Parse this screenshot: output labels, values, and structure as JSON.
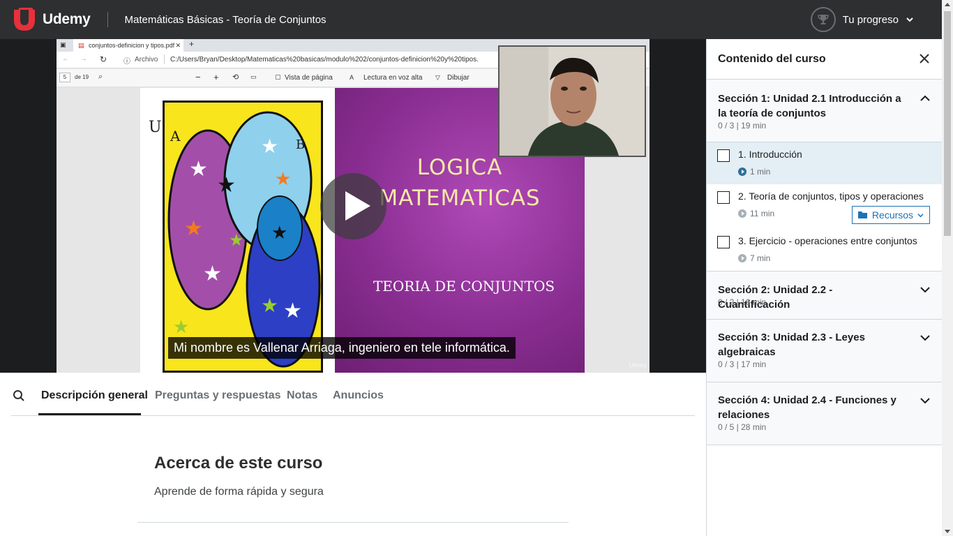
{
  "header": {
    "logo_text": "Udemy",
    "course_title": "Matemáticas Básicas - Teoría de Conjuntos",
    "progress_label": "Tu progreso"
  },
  "video": {
    "pdf_tab_title": "conjuntos-definicion y tipos.pdf",
    "address_archivo": "Archivo",
    "address_path": "C:/Users/Bryan/Desktop/Matematicas%20basicas/modulo%202/conjuntos-definicion%20y%20tipos.",
    "page_num": "5",
    "page_total": "de 19",
    "toolbar_vista": "Vista de página",
    "toolbar_lectura": "Lectura en voz alta",
    "toolbar_dibujar": "Dibujar",
    "venn_label_u": "U",
    "venn_label_a": "A",
    "venn_label_b": "B",
    "slide_title_1": "LOGICA",
    "slide_title_2": "MATEMATICAS",
    "slide_subtitle": "TEORIA DE CONJUNTOS",
    "caption": "Mi nombre es Vallenar Arriaga, ingeniero en tele informática.",
    "watermark": "Udemy"
  },
  "tabs": [
    {
      "label": "Descripción general",
      "active": true
    },
    {
      "label": "Preguntas y respuestas",
      "active": false
    },
    {
      "label": "Notas",
      "active": false
    },
    {
      "label": "Anuncios",
      "active": false
    }
  ],
  "about": {
    "title": "Acerca de este curso",
    "text": "Aprende de forma rápida y segura"
  },
  "sidebar": {
    "title": "Contenido del curso",
    "sections": [
      {
        "title": "Sección 1: Unidad 2.1 Introducción a la teoría de conjuntos",
        "meta": "0 / 3 | 19 min",
        "expanded": true,
        "lectures": [
          {
            "title": "1. Introducción",
            "duration": "1 min",
            "active": true
          },
          {
            "title": "2. Teoría de conjuntos, tipos y operaciones",
            "duration": "11 min",
            "resources": "Recursos"
          },
          {
            "title": "3. Ejercicio - operaciones entre conjuntos",
            "duration": "7 min"
          }
        ]
      },
      {
        "title": "Sección 2: Unidad 2.2 - Cuantificación",
        "meta": "0 / 2 | 16 min",
        "expanded": false
      },
      {
        "title": "Sección 3: Unidad 2.3 - Leyes algebraicas",
        "meta": "0 / 3 | 17 min",
        "expanded": false
      },
      {
        "title": "Sección 4: Unidad 2.4 - Funciones y relaciones",
        "meta": "0 / 5 | 28 min",
        "expanded": false
      }
    ]
  },
  "colors": {
    "header_bg": "#2d2f31",
    "logo_accent": "#a435f0",
    "active_lecture_bg": "#e3eef5",
    "resource_blue": "#1a73b8"
  }
}
